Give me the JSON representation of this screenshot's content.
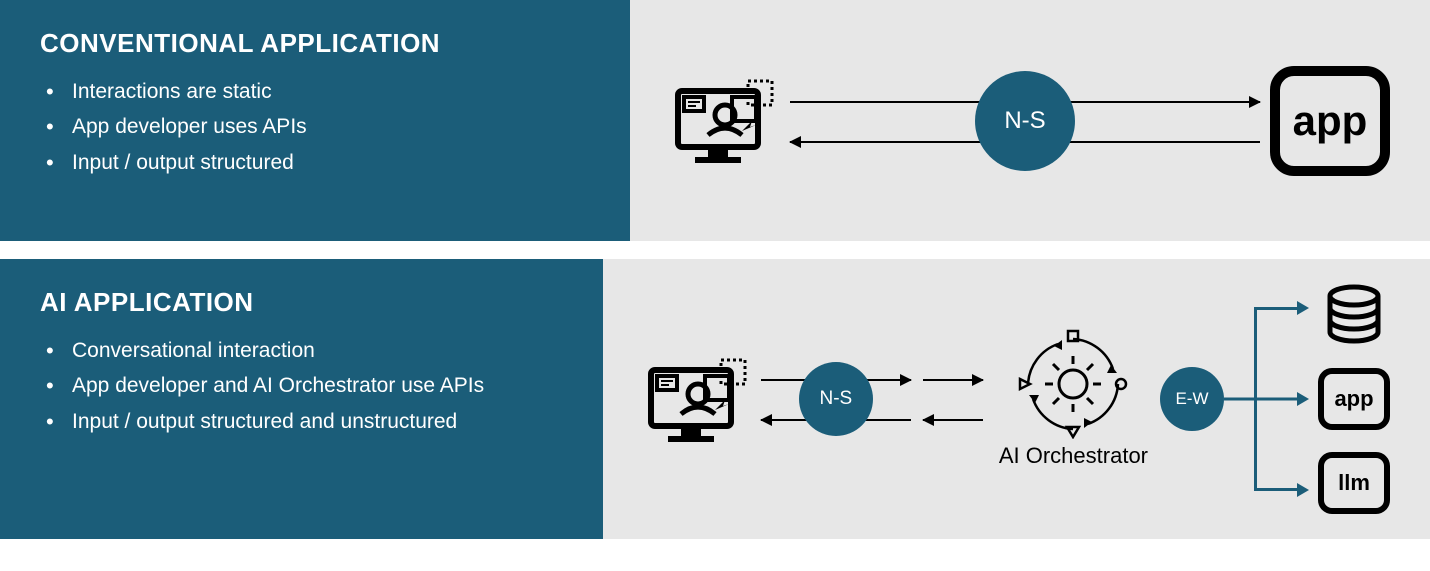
{
  "row1": {
    "title": "CONVENTIONAL APPLICATION",
    "bullets": [
      "Interactions are static",
      "App developer uses APIs",
      "Input / output structured"
    ],
    "badge": "N-S",
    "app_label": "app"
  },
  "row2": {
    "title": "AI APPLICATION",
    "bullets": [
      "Conversational interaction",
      "App developer and AI Orchestrator use APIs",
      "Input / output structured and unstructured"
    ],
    "badge_ns": "N-S",
    "badge_ew": "E-W",
    "orchestrator_label": "AI Orchestrator",
    "targets": {
      "app": "app",
      "llm": "llm"
    }
  }
}
